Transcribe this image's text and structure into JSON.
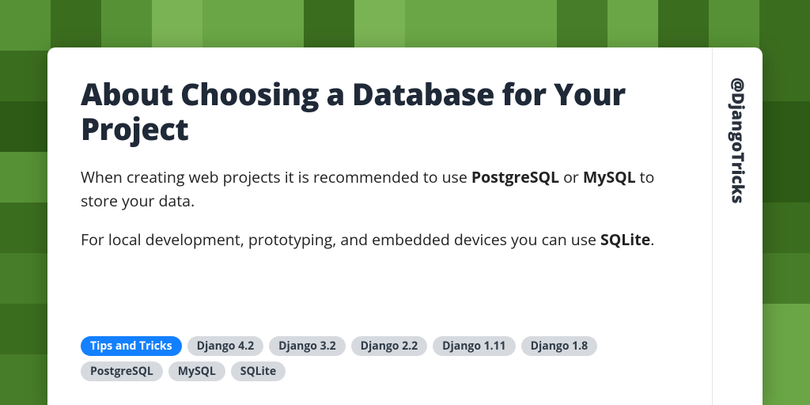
{
  "bg": {
    "shades": [
      "#2e5c16",
      "#3b6d1f",
      "#477d28",
      "#569235",
      "#6aa645",
      "#7ab354"
    ],
    "cols": 16,
    "rows": 8
  },
  "article": {
    "title": "About Choosing a Database for Your Project",
    "para1_pre": "When creating web projects it is recommended to use ",
    "para1_b1": "PostgreSQL",
    "para1_mid": " or ",
    "para1_b2": "MySQL",
    "para1_post": " to store your data.",
    "para2_pre": "For local development, prototyping, and embedded devices you can use ",
    "para2_b1": "SQLite",
    "para2_post": "."
  },
  "tags": [
    {
      "label": "Tips and Tricks",
      "primary": true
    },
    {
      "label": "Django 4.2",
      "primary": false
    },
    {
      "label": "Django 3.2",
      "primary": false
    },
    {
      "label": "Django 2.2",
      "primary": false
    },
    {
      "label": "Django 1.11",
      "primary": false
    },
    {
      "label": "Django 1.8",
      "primary": false
    },
    {
      "label": "PostgreSQL",
      "primary": false
    },
    {
      "label": "MySQL",
      "primary": false
    },
    {
      "label": "SQLite",
      "primary": false
    }
  ],
  "handle": "@DjangoTricks"
}
